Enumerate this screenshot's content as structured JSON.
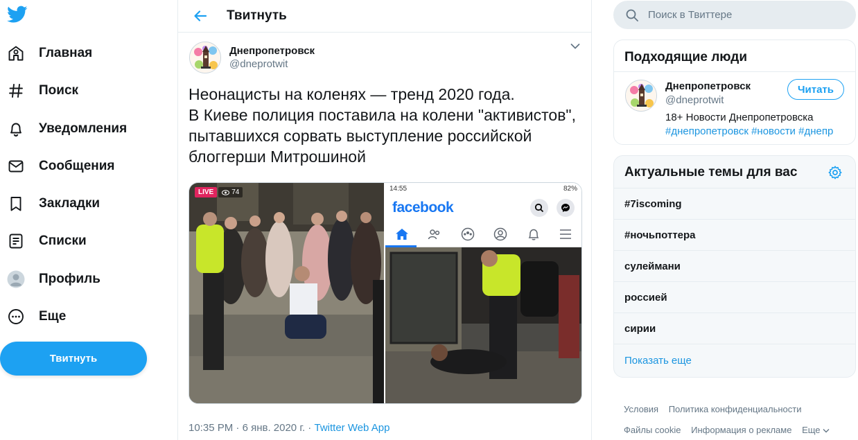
{
  "colors": {
    "accent": "#1da1f2",
    "link": "#1b95e0",
    "text": "#14171a",
    "muted": "#657786",
    "border": "#e6ecf0",
    "live": "#e0245e",
    "facebook": "#1877f2",
    "vest": "#c8e62a"
  },
  "nav": {
    "logo_icon": "twitter-bird-icon",
    "items": [
      {
        "label": "Главная",
        "icon": "home-icon"
      },
      {
        "label": "Поиск",
        "icon": "hashtag-icon"
      },
      {
        "label": "Уведомления",
        "icon": "bell-icon"
      },
      {
        "label": "Сообщения",
        "icon": "envelope-icon"
      },
      {
        "label": "Закладки",
        "icon": "bookmark-icon"
      },
      {
        "label": "Списки",
        "icon": "list-icon"
      },
      {
        "label": "Профиль",
        "icon": "profile-avatar-icon"
      },
      {
        "label": "Еще",
        "icon": "more-icon"
      }
    ],
    "tweet_button": "Твитнуть"
  },
  "main": {
    "title": "Твитнуть",
    "author": {
      "name": "Днепропетровск",
      "handle": "@dneprotwit"
    },
    "text_lines": [
      "Неонацисты на коленях — тренд 2020 года.",
      "В Киеве полиция поставила на колени \"активистов\",",
      "пытавшихся сорвать выступление российской",
      "блоггерши Митрошиной"
    ],
    "media": {
      "left": {
        "live_label": "LIVE",
        "viewers": "74"
      },
      "right": {
        "status_time": "14:55",
        "battery": "82%",
        "brand": "facebook"
      }
    },
    "meta": {
      "time": "10:35 PM",
      "separator": " · ",
      "date": "6 янв. 2020 г.",
      "separator2": " · ",
      "source": "Twitter Web App"
    }
  },
  "search": {
    "placeholder": "Поиск в Твиттере"
  },
  "who_to_follow": {
    "title": "Подходящие люди",
    "user": {
      "name": "Днепропетровск",
      "handle": "@dneprotwit",
      "follow_label": "Читать",
      "bio": "18+ Новости Днепропетровска",
      "tags": "#днепропетровск #новости #днепр"
    }
  },
  "trends": {
    "title": "Актуальные темы для вас",
    "items": [
      "#7iscoming",
      "#ночьпоттера",
      "сулеймани",
      "россией",
      "сирии"
    ],
    "show_more": "Показать еще"
  },
  "footer": {
    "links": [
      "Условия",
      "Политика конфиденциальности",
      "Файлы cookie",
      "Информация о рекламе",
      "Еще"
    ]
  }
}
